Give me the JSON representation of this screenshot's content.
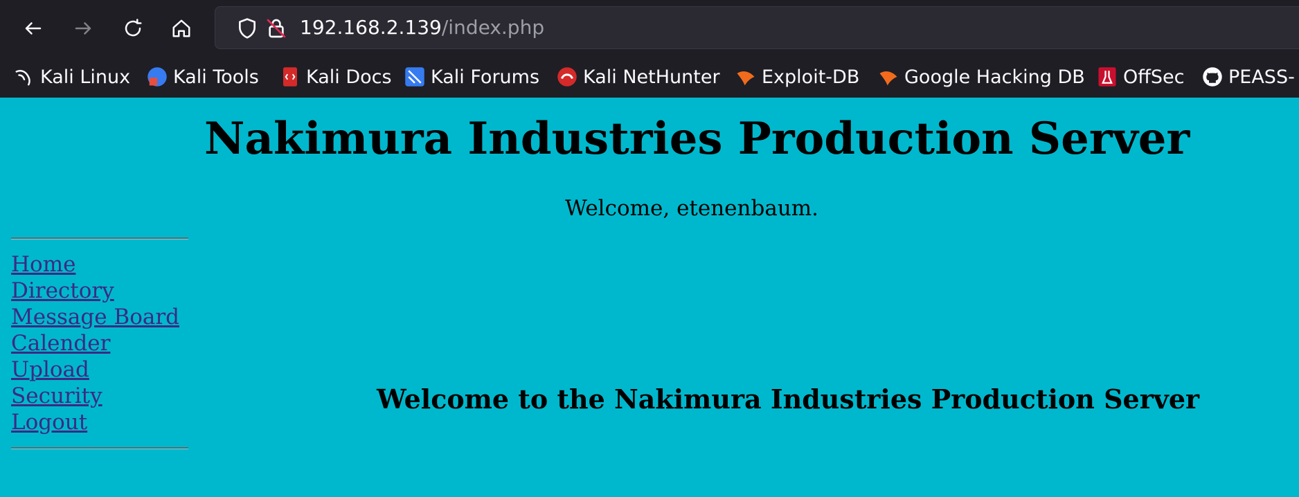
{
  "browser": {
    "url_host": "192.168.2.139",
    "url_path": "/index.php",
    "bookmarks": [
      {
        "label": "Kali Linux",
        "icon": "kali-dragon-icon"
      },
      {
        "label": "Kali Tools",
        "icon": "kali-tools-icon"
      },
      {
        "label": "Kali Docs",
        "icon": "kali-docs-icon"
      },
      {
        "label": "Kali Forums",
        "icon": "kali-forums-icon"
      },
      {
        "label": "Kali NetHunter",
        "icon": "kali-nethunter-icon"
      },
      {
        "label": "Exploit-DB",
        "icon": "exploit-db-icon"
      },
      {
        "label": "Google Hacking DB",
        "icon": "ghdb-icon"
      },
      {
        "label": "OffSec",
        "icon": "offsec-icon"
      },
      {
        "label": "PEASS-",
        "icon": "github-icon"
      }
    ]
  },
  "page": {
    "title": "Nakimura Industries Production Server",
    "welcome": "Welcome, etenenbaum.",
    "menu": [
      "Home",
      "Directory",
      "Message Board",
      "Calender",
      "Upload",
      "Security",
      "Logout"
    ],
    "subtitle": "Welcome to the Nakimura Industries Production Server"
  },
  "colors": {
    "page_background": "#00b8cd",
    "link": "#3b2a86",
    "chrome_background": "#1f1e25",
    "urlbar_background": "#2b2a33"
  }
}
